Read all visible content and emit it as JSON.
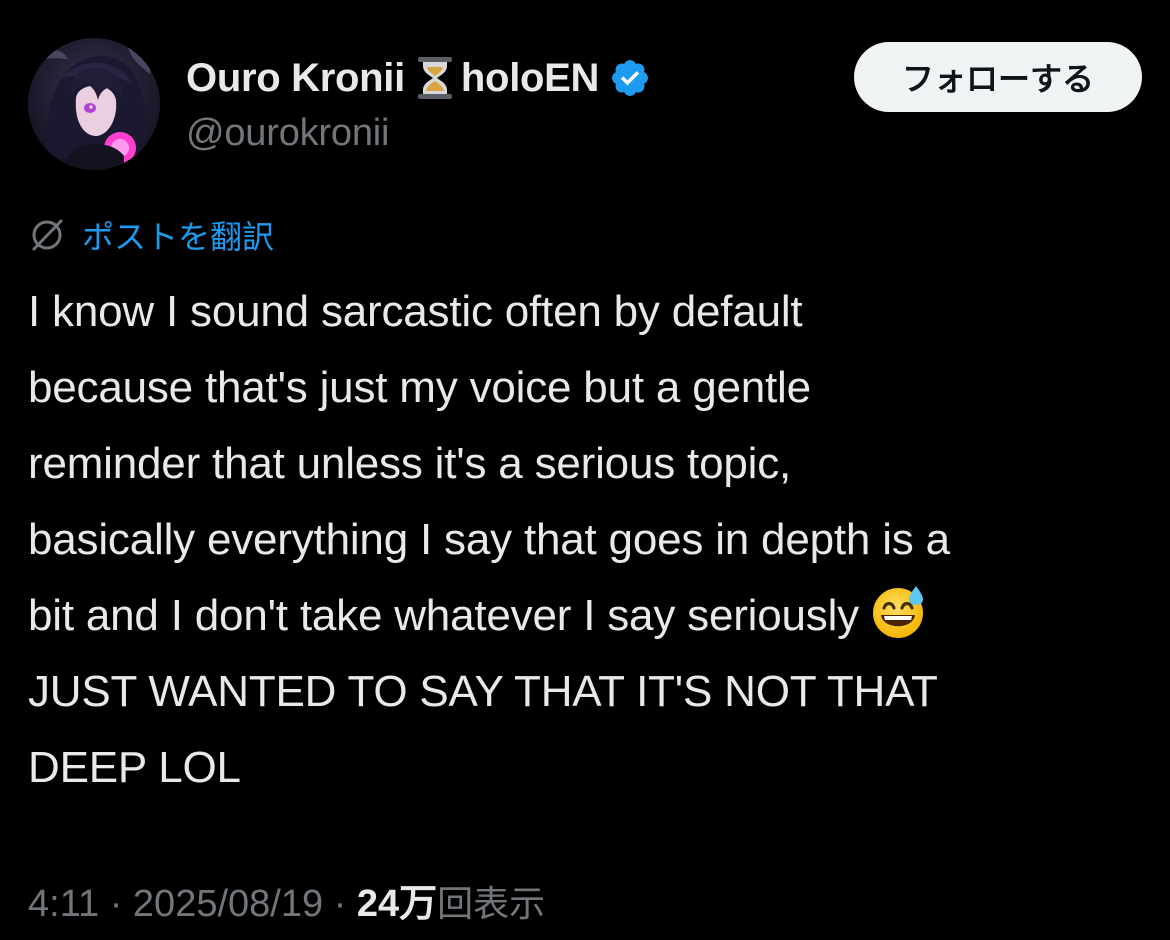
{
  "tweet": {
    "author": {
      "display_name_part1": "Ouro Kronii",
      "display_name_part2": "holoEN",
      "handle": "@ourokronii",
      "name_emoji": "hourglass-icon",
      "verified": true
    },
    "follow_label": "フォローする",
    "translate_label": "ポストを翻訳",
    "text_lines": [
      "I know I sound sarcastic often by default",
      "because that's just my voice but a gentle",
      "reminder that unless it's a serious topic,",
      "basically everything I say that goes in depth is a",
      "bit and I don't take whatever I say seriously",
      "JUST WANTED TO SAY THAT IT'S NOT THAT",
      "DEEP LOL"
    ],
    "inline_emoji": "grinning-sweat-emoji",
    "time": "4:11",
    "separator": "·",
    "date": "2025/08/19",
    "views_count": "24万",
    "views_label": "回表示"
  },
  "colors": {
    "background": "#000000",
    "text": "#e7e9ea",
    "secondary": "#71767b",
    "link": "#1d9bf0",
    "verified": "#1d9bf0",
    "button_bg": "#eff3f4"
  }
}
